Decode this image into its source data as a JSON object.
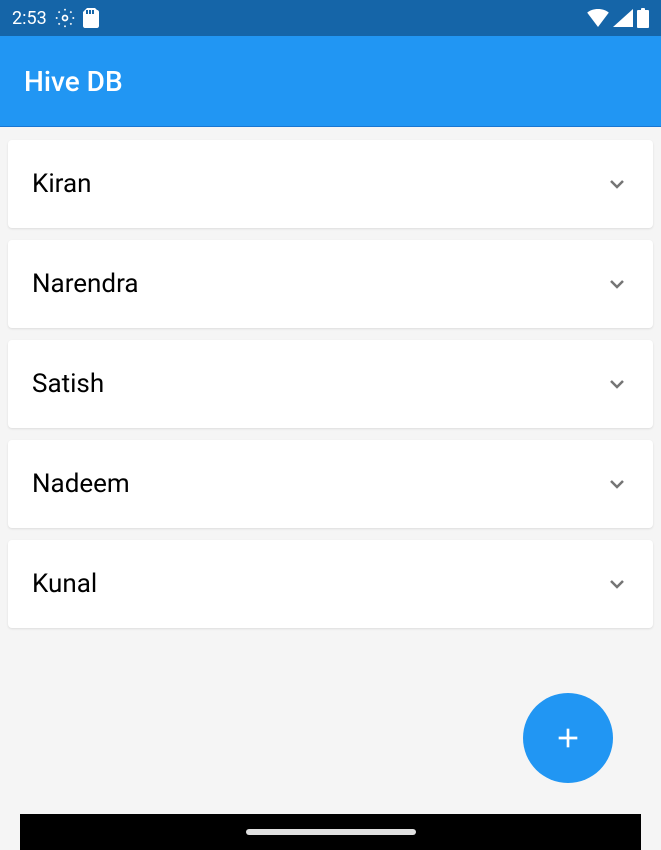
{
  "statusBar": {
    "time": "2:53"
  },
  "appBar": {
    "title": "Hive DB"
  },
  "listItems": [
    {
      "name": "Kiran"
    },
    {
      "name": "Narendra"
    },
    {
      "name": "Satish"
    },
    {
      "name": "Nadeem"
    },
    {
      "name": "Kunal"
    }
  ]
}
